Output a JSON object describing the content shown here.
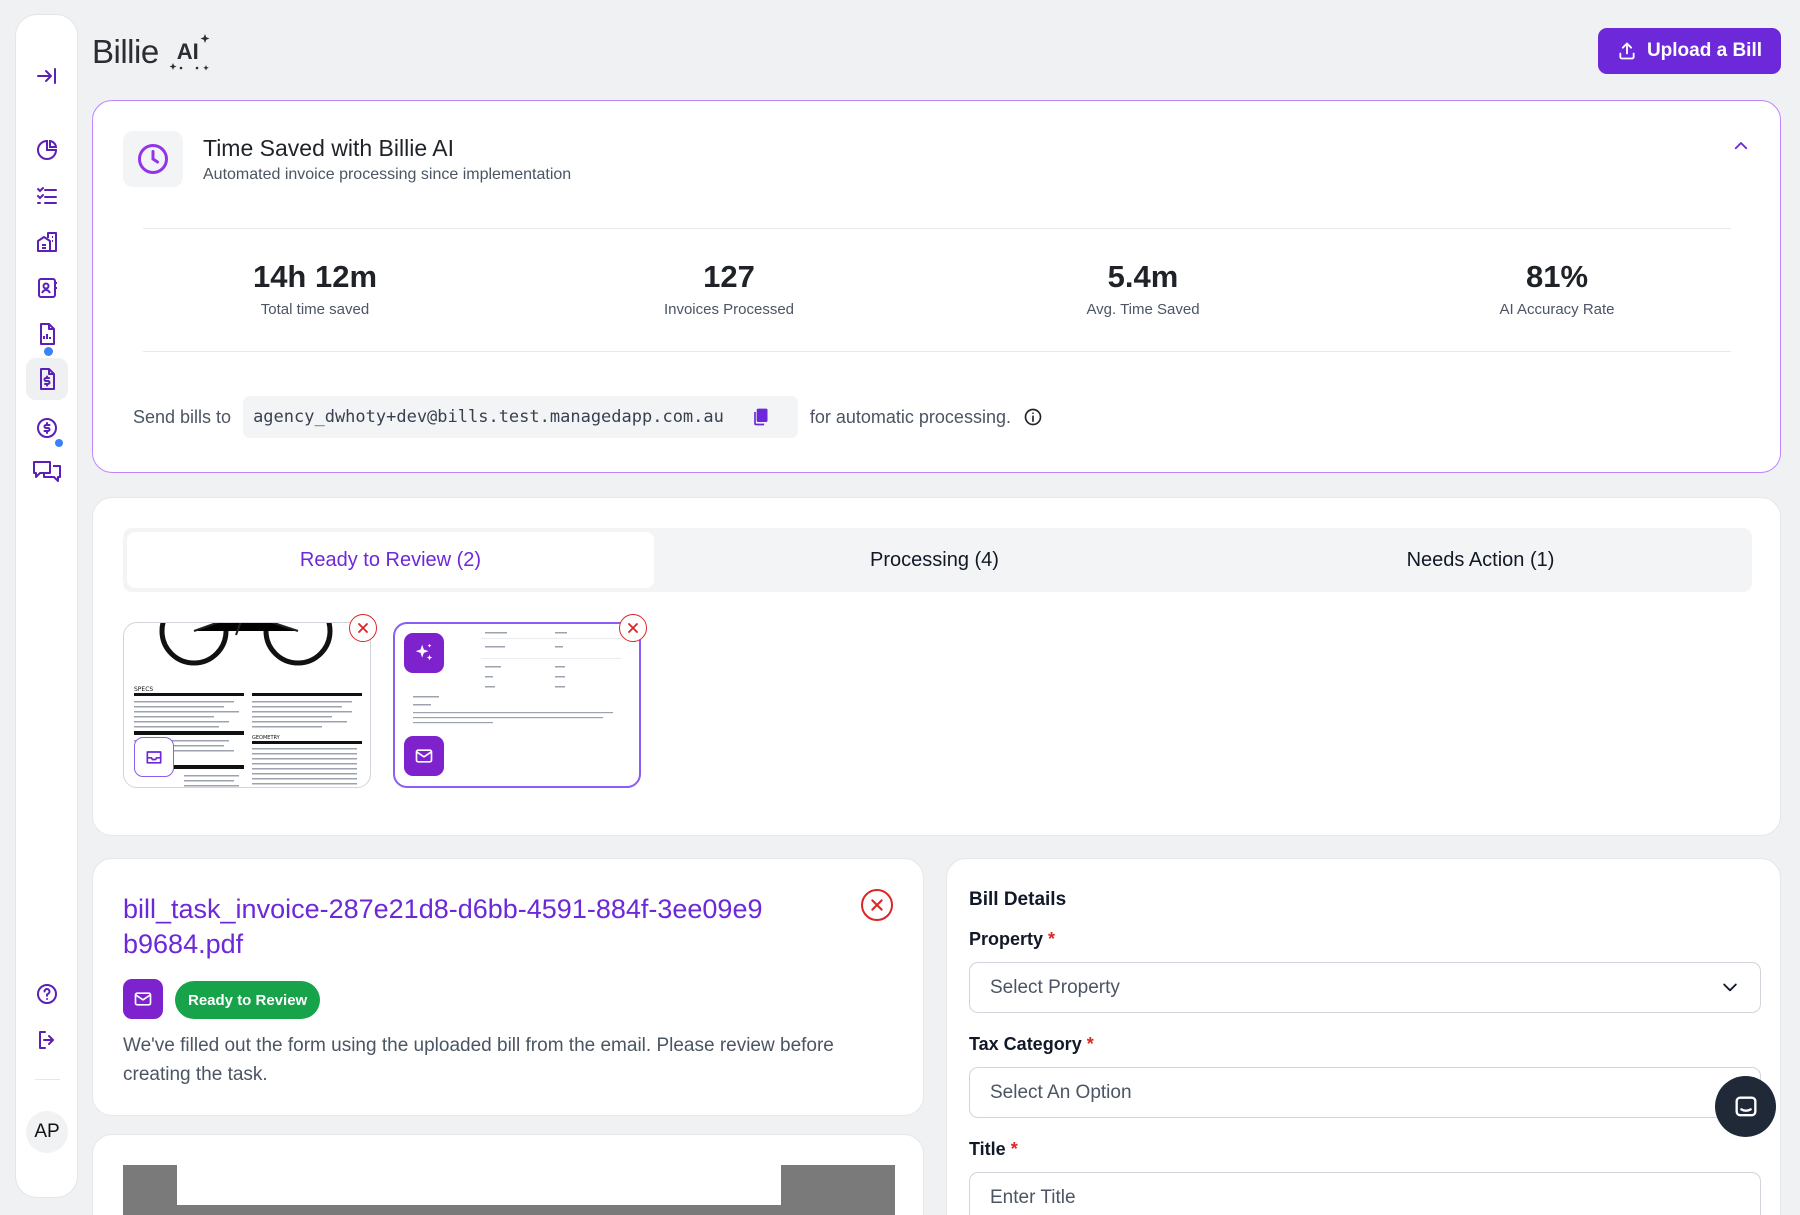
{
  "app": {
    "brand": "Billie",
    "brand_badge": "AI",
    "accent_color": "#6d28d9",
    "user_initials": "AP"
  },
  "header": {
    "upload_button_label": "Upload a Bill"
  },
  "sidebar": {
    "items": [
      {
        "icon": "expand-icon"
      },
      {
        "icon": "pie-chart-icon"
      },
      {
        "icon": "checklist-icon"
      },
      {
        "icon": "buildings-icon"
      },
      {
        "icon": "contact-card-icon"
      },
      {
        "icon": "report-icon"
      },
      {
        "icon": "invoice-icon",
        "active": true,
        "badge": true
      },
      {
        "icon": "dollar-circle-icon"
      },
      {
        "icon": "chat-icon",
        "badge": true
      }
    ],
    "bottom_items": [
      {
        "icon": "help-icon"
      },
      {
        "icon": "logout-icon"
      }
    ]
  },
  "time_saved": {
    "title": "Time Saved with Billie AI",
    "subtitle": "Automated invoice processing since implementation",
    "stats": [
      {
        "value": "14h 12m",
        "label": "Total time saved"
      },
      {
        "value": "127",
        "label": "Invoices Processed"
      },
      {
        "value": "5.4m",
        "label": "Avg. Time Saved"
      },
      {
        "value": "81%",
        "label": "AI Accuracy Rate"
      }
    ],
    "send_prefix": "Send bills to",
    "email": "agency_dwhoty+dev@bills.test.managedapp.com.au",
    "send_suffix": "for automatic processing."
  },
  "tabs": [
    {
      "label": "Ready to Review (2)",
      "active": true
    },
    {
      "label": "Processing (4)",
      "active": false
    },
    {
      "label": "Needs Action (1)",
      "active": false
    }
  ],
  "file": {
    "name": "bill_task_invoice-287e21d8-d6bb-4591-884f-3ee09e9b9684.pdf",
    "status": "Ready to Review",
    "status_color": "#16a34a",
    "description": "We've filled out the form using the uploaded bill from the email. Please review before creating the task."
  },
  "bill_details": {
    "title": "Bill Details",
    "required_marker": "*",
    "fields": [
      {
        "label": "Property",
        "placeholder": "Select Property"
      },
      {
        "label": "Tax Category",
        "placeholder": "Select An Option"
      },
      {
        "label": "Title",
        "placeholder": "Enter Title"
      }
    ]
  }
}
